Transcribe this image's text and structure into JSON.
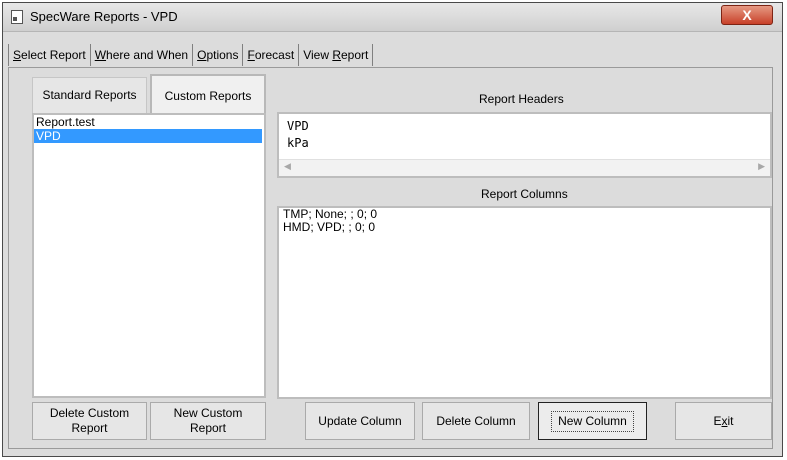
{
  "window": {
    "title": "SpecWare Reports - VPD",
    "close_glyph": "X"
  },
  "menu": [
    {
      "pre": "",
      "key": "S",
      "post": "elect Report"
    },
    {
      "pre": "",
      "key": "W",
      "post": "here and When"
    },
    {
      "pre": "",
      "key": "O",
      "post": "ptions"
    },
    {
      "pre": "",
      "key": "F",
      "post": "orecast"
    },
    {
      "pre": "View ",
      "key": "R",
      "post": "eport"
    }
  ],
  "tabs": {
    "standard": "Standard Reports",
    "custom": "Custom Reports",
    "active": "custom"
  },
  "report_list": {
    "items": [
      "Report.test",
      "VPD"
    ],
    "selected": "VPD"
  },
  "headers_panel": {
    "label": "Report Headers",
    "lines": [
      "VPD",
      "kPa"
    ]
  },
  "columns_panel": {
    "label": "Report Columns",
    "rows": [
      "TMP; None; ; 0; 0",
      "HMD; VPD; ; 0; 0"
    ]
  },
  "buttons": {
    "delete_custom_1": "Delete Custom",
    "delete_custom_2": "Report",
    "new_custom_1": "New Custom",
    "new_custom_2": "Report",
    "update_column": "Update Column",
    "delete_column": "Delete Column",
    "new_column": "New Column",
    "exit_pre": "E",
    "exit_key": "x",
    "exit_post": "it"
  },
  "colors": {
    "selection": "#3399ff",
    "close_button": "#c8412a",
    "window_bg": "#dcdcdc"
  }
}
